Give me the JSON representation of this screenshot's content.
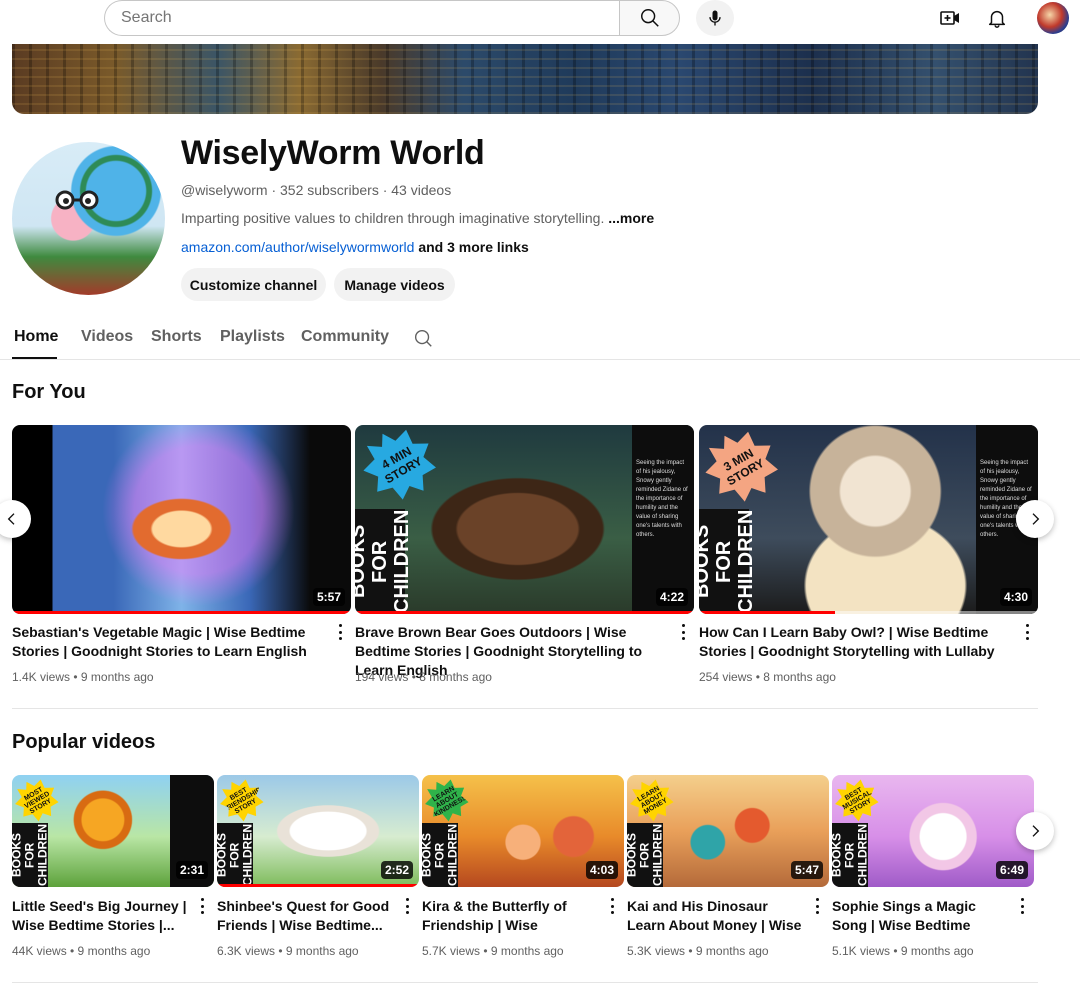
{
  "search": {
    "placeholder": "Search"
  },
  "channel": {
    "title": "WiselyWorm World",
    "meta": "@wiselyworm · 352 subscribers · 43 videos",
    "description": "Imparting positive values to children through imaginative storytelling.",
    "description_more": "...more",
    "link": "amazon.com/author/wiselywormworld",
    "more_links": "and 3 more links",
    "customize_label": "Customize channel",
    "manage_label": "Manage videos"
  },
  "tabs": [
    "Home",
    "Videos",
    "Shorts",
    "Playlists",
    "Community"
  ],
  "for_you": {
    "title": "For You",
    "videos": [
      {
        "title": "Sebastian's Vegetable Magic | Wise Bedtime Stories | Goodnight Stories to Learn English",
        "meta": "1.4K views • 9 months ago",
        "duration": "5:57",
        "watched": 1.0
      },
      {
        "title": "Brave Brown Bear Goes Outdoors | Wise Bedtime Stories | Goodnight Storytelling to Learn English",
        "meta": "194 views • 8 months ago",
        "duration": "4:22",
        "watched": 1.0,
        "side_label": "BOOKS FOR CHILDREN",
        "badge": "4 MIN STORY",
        "panel_text": "Seeing the impact of his jealousy, Snowy gently reminded Zidane of the importance of humility and the value of sharing one's talents with others."
      },
      {
        "title": "How Can I Learn Baby Owl? | Wise Bedtime Stories | Goodnight Storytelling with Lullaby",
        "meta": "254 views • 8 months ago",
        "duration": "4:30",
        "watched": 0.4,
        "side_label": "BOOKS FOR CHILDREN",
        "badge": "3 MIN STORY",
        "panel_text": "Seeing the impact of his jealousy, Snowy gently reminded Zidane of the importance of humility and the value of sharing one's talents with others."
      }
    ]
  },
  "popular": {
    "title": "Popular videos",
    "videos": [
      {
        "title": "Little Seed's Big Journey | Wise Bedtime Stories |...",
        "meta": "44K views • 9 months ago",
        "duration": "2:31",
        "watched": 0,
        "side_label": "BOOKS FOR CHILDREN",
        "badge": "MOST VIEWED STORY"
      },
      {
        "title": "Shinbee's Quest for Good Friends | Wise Bedtime...",
        "meta": "6.3K views • 9 months ago",
        "duration": "2:52",
        "watched": 1.0,
        "side_label": "BOOKS FOR CHILDREN",
        "badge": "BEST FRIENDSHIP STORY"
      },
      {
        "title": "Kira & the Butterfly of Friendship | Wise Bedtime...",
        "meta": "5.7K views • 9 months ago",
        "duration": "4:03",
        "watched": 0,
        "side_label": "BOOKS FOR CHILDREN",
        "badge": "LEARN ABOUT KINDNESS"
      },
      {
        "title": "Kai and His Dinosaur Learn About Money | Wise Bedtim...",
        "meta": "5.3K views • 9 months ago",
        "duration": "5:47",
        "watched": 0,
        "side_label": "BOOKS FOR CHILDREN",
        "badge": "LEARN ABOUT MONEY"
      },
      {
        "title": "Sophie Sings a Magic Song | Wise Bedtime Stories |...",
        "meta": "5.1K views • 9 months ago",
        "duration": "6:49",
        "watched": 0,
        "side_label": "BOOKS FOR CHILDREN",
        "badge": "BEST MUSICAL STORY"
      }
    ]
  },
  "colors": {
    "link": "#065fd4",
    "progress": "#ff0000",
    "text_secondary": "#606060"
  }
}
